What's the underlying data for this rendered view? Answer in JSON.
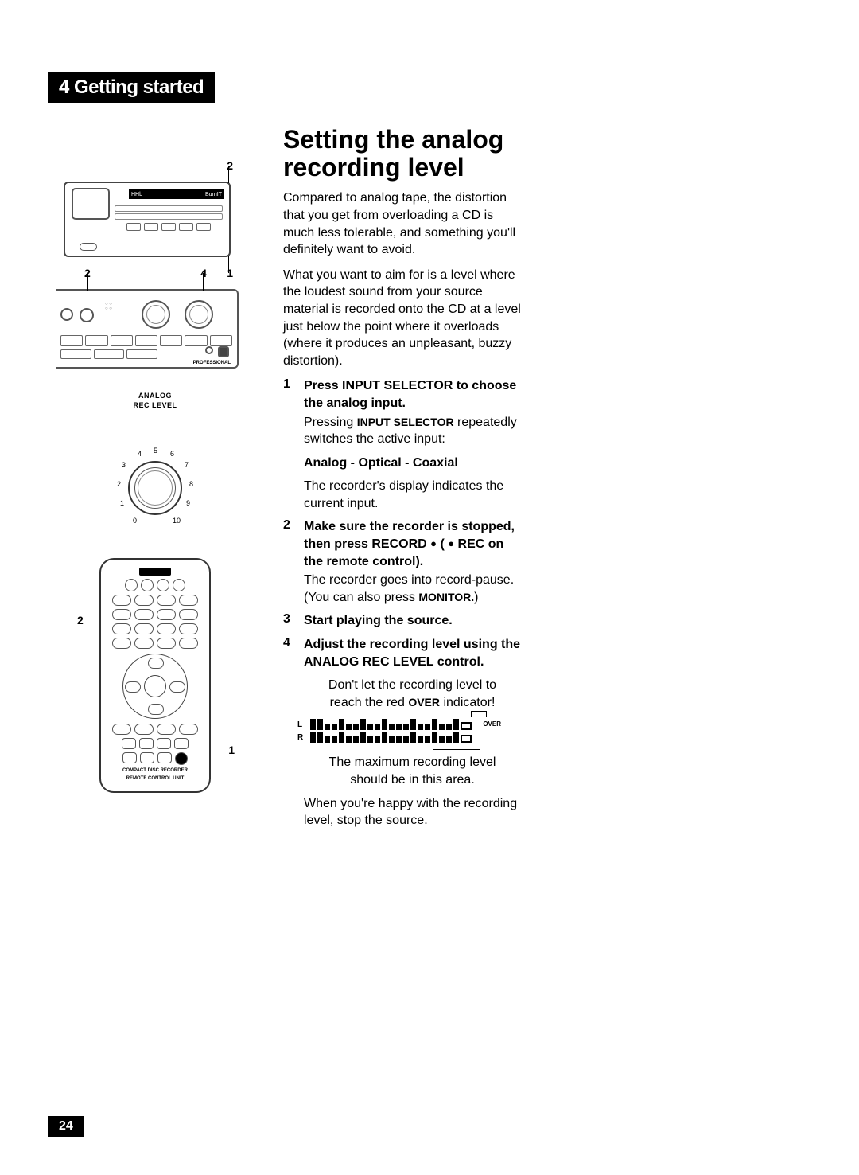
{
  "section_header": "4 Getting started",
  "title": "Setting the analog recording level",
  "intro_p1": "Compared to analog tape, the distortion that you get from overloading a CD is much less tolerable, and something you'll definitely want to avoid.",
  "intro_p2": "What you want to aim for is a level where the loudest sound from your source material is recorded onto the CD at a level just below the point where it overloads (where it produces an unpleasant, buzzy distortion).",
  "steps": {
    "s1": {
      "num": "1",
      "head": "Press INPUT SELECTOR to choose the analog input.",
      "sub1a": "Pressing ",
      "sub1b": "INPUT SELECTOR",
      "sub1c": " repeatedly switches the active input:",
      "cycle": "Analog - Optical - Coaxial",
      "sub2": "The recorder's display indicates the current input."
    },
    "s2": {
      "num": "2",
      "head_a": "Make sure the recorder is stopped, then press RECORD ",
      "head_b": " ( ",
      "head_c": " REC on the remote control).",
      "sub_a": "The recorder goes into record-pause. (You can also press ",
      "sub_b": "MONITOR.",
      "sub_c": ")"
    },
    "s3": {
      "num": "3",
      "head": "Start playing the source."
    },
    "s4": {
      "num": "4",
      "head": "Adjust the recording level using the ANALOG REC LEVEL control.",
      "warn_a": "Don't let the recording level to reach the red ",
      "warn_b": "OVER",
      "warn_c": " indicator!",
      "meter_note": "The maximum recording level should be in this area.",
      "closing": "When you're happy with the recording level, stop the source."
    }
  },
  "diagrams": {
    "unit_top": {
      "callout1": "1",
      "callout2": "2",
      "logo_left": "HHb",
      "logo_right": "BurnIT"
    },
    "unit_bottom": {
      "callout2": "2",
      "callout4": "4",
      "professional": "PROFESSIONAL"
    },
    "dial": {
      "label1": "ANALOG",
      "label2": "REC LEVEL",
      "ticks": [
        "0",
        "1",
        "2",
        "3",
        "4",
        "5",
        "6",
        "7",
        "8",
        "9",
        "10"
      ]
    },
    "remote": {
      "callout1": "1",
      "callout2": "2",
      "footer1": "COMPACT DISC RECORDER",
      "footer2": "REMOTE CONTROL UNIT"
    },
    "meter": {
      "L": "L",
      "R": "R",
      "over": "OVER"
    }
  },
  "page_number": "24"
}
